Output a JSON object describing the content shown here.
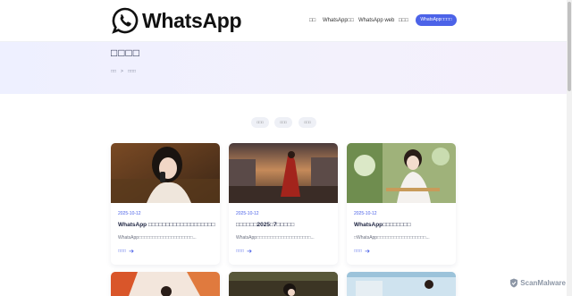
{
  "header": {
    "logo_text": "WhatsApp",
    "nav": [
      {
        "label": "□□"
      },
      {
        "label": "WhatsApp□□"
      },
      {
        "label": "WhatsApp web"
      },
      {
        "label": "□□□"
      }
    ],
    "cta_label": "WhatsApp□□□□"
  },
  "hero": {
    "title": "□□□□",
    "breadcrumb": [
      "□□",
      ">",
      "□□□"
    ]
  },
  "filters": [
    "□□□",
    "□□□",
    "□□□"
  ],
  "cards": [
    {
      "date": "2025-10-12",
      "title": "WhatsApp □□□□□□□□□□□□□□□□□□□",
      "excerpt": "WhatsApp□□□□□□□□□□□□□□□□□□□□...",
      "more": "□□□"
    },
    {
      "date": "2025-10-12",
      "title": "□□□□□□2025□7□□□□□",
      "excerpt": "WhatsApp□□□□□□□□□□□□□□□□□□□□...",
      "more": "□□□"
    },
    {
      "date": "2025-10-12",
      "title": "WhatsApp□□□□□□□□",
      "excerpt": "□WhatsApp□□□□□□□□□□□□□□□□□□...",
      "more": "□□□"
    }
  ],
  "watermark": "ScanMalware",
  "colors": {
    "accent": "#4c63e8",
    "text": "#1c2340",
    "date": "#4c63e8"
  },
  "icons": [
    "whatsapp-logo-icon",
    "arrow-right-icon",
    "shield-icon"
  ]
}
